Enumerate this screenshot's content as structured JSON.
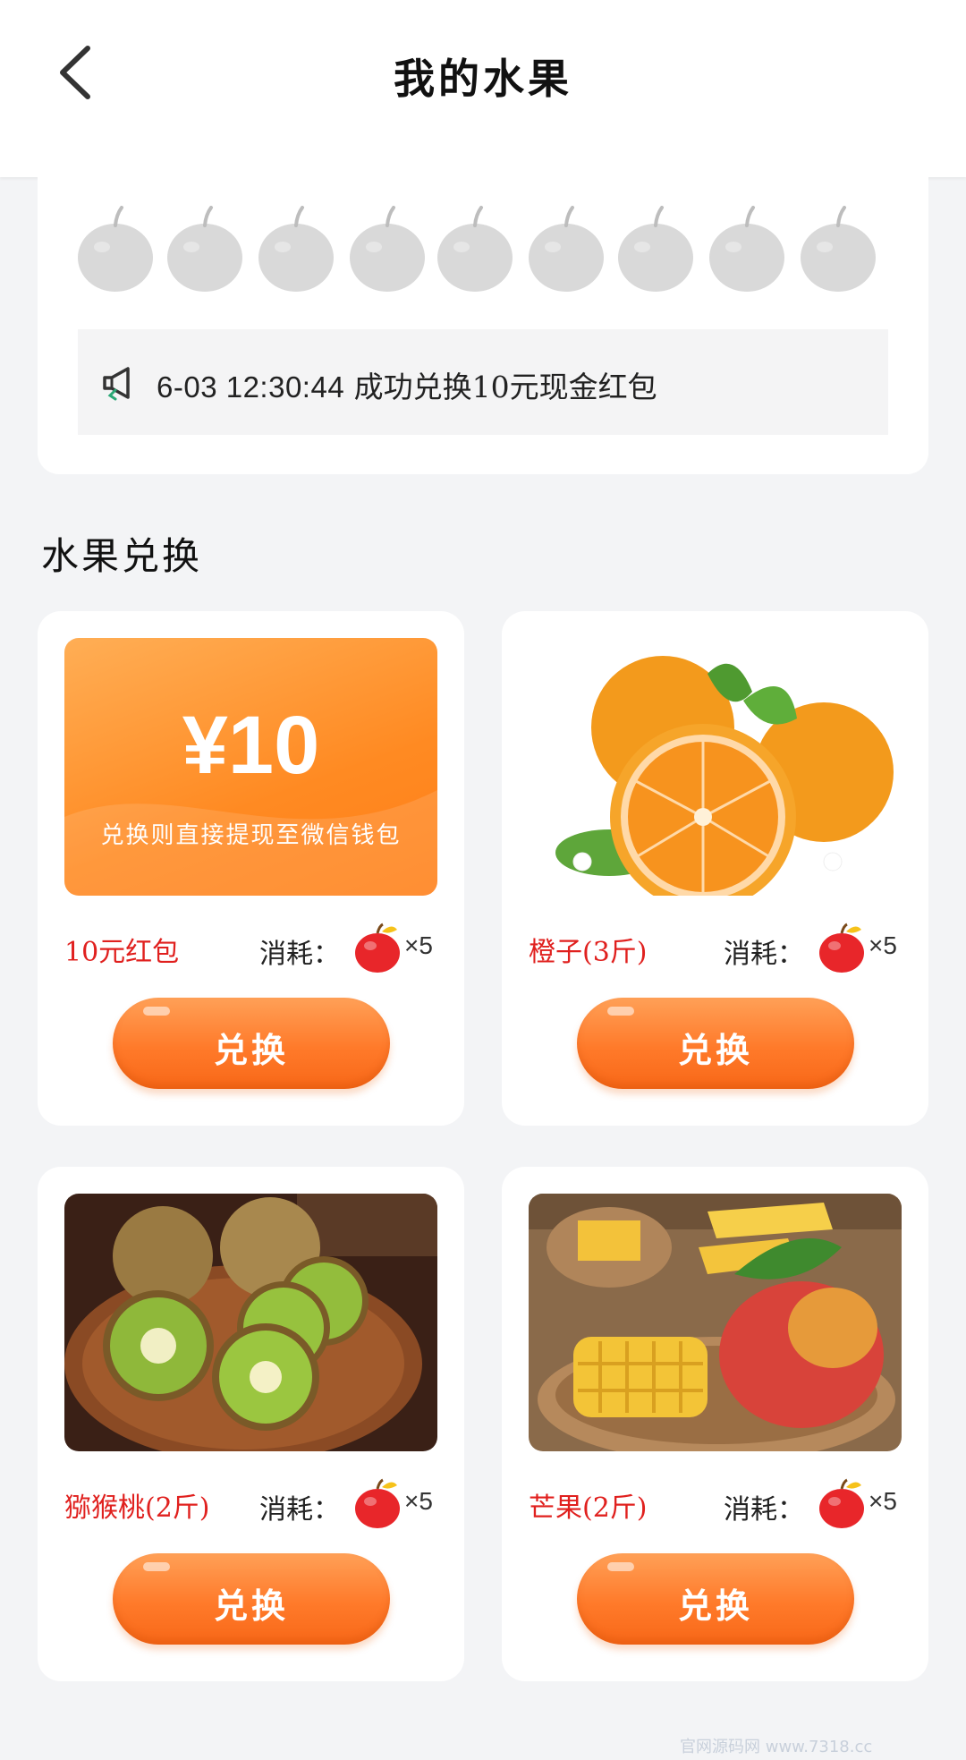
{
  "header": {
    "title": "我的水果",
    "back_icon": "chevron-left-icon"
  },
  "fruit_slots": {
    "count": 9,
    "filled": 0,
    "empty_color": "#d9d9d9"
  },
  "notice": {
    "icon": "megaphone-icon",
    "timestamp": "6-03 12:30:44",
    "message": " 成功兑换10元现金红包"
  },
  "section": {
    "title": "水果兑换"
  },
  "products": [
    {
      "name": "10元红包",
      "cost_label": "消耗：",
      "cost_times": "×5",
      "button": "兑换",
      "image": "red-packet",
      "amount": "¥10",
      "subtitle": "兑换则直接提现至微信钱包"
    },
    {
      "name": "橙子(3斤)",
      "cost_label": "消耗：",
      "cost_times": "×5",
      "button": "兑换",
      "image": "orange-photo"
    },
    {
      "name": "猕猴桃(2斤)",
      "cost_label": "消耗：",
      "cost_times": "×5",
      "button": "兑换",
      "image": "kiwi-photo"
    },
    {
      "name": "芒果(2斤)",
      "cost_label": "消耗：",
      "cost_times": "×5",
      "button": "兑换",
      "image": "mango-photo"
    }
  ],
  "colors": {
    "accent": "#ff7a2a",
    "product_name": "#e0201e",
    "background": "#f3f4f6"
  },
  "watermark": "官网源码网 www.7318.cc"
}
